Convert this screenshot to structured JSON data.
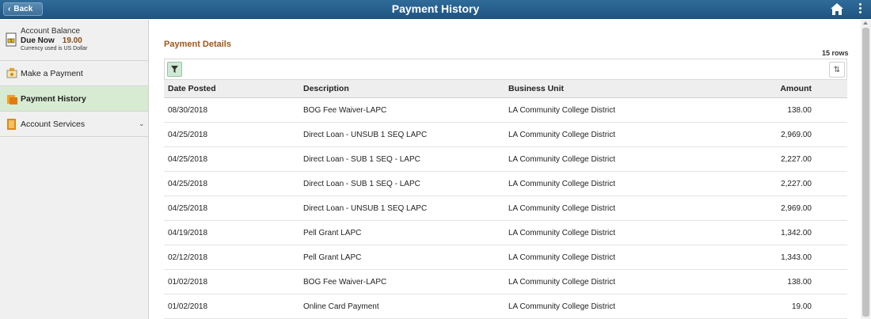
{
  "header": {
    "back_label": "Back",
    "title": "Payment History",
    "home_icon": "home-icon",
    "menu_icon": "kebab-menu-icon"
  },
  "sidebar": {
    "account": {
      "title": "Account Balance",
      "due_label": "Due Now",
      "due_amount": "19.00",
      "currency_note": "Currency used is US Dollar"
    },
    "items": [
      {
        "label": "Make a Payment",
        "icon": "payment-icon",
        "active": false
      },
      {
        "label": "Payment History",
        "icon": "history-icon",
        "active": true
      },
      {
        "label": "Account Services",
        "icon": "services-icon",
        "active": false,
        "expandable": true
      }
    ]
  },
  "main": {
    "section_title": "Payment Details",
    "row_count": "15 rows",
    "columns": [
      "Date Posted",
      "Description",
      "Business Unit",
      "Amount"
    ],
    "rows": [
      [
        "08/30/2018",
        "BOG Fee Waiver-LAPC",
        "LA Community College District",
        "138.00"
      ],
      [
        "04/25/2018",
        "Direct Loan - UNSUB 1 SEQ LAPC",
        "LA Community College District",
        "2,969.00"
      ],
      [
        "04/25/2018",
        "Direct Loan - SUB 1 SEQ - LAPC",
        "LA Community College District",
        "2,227.00"
      ],
      [
        "04/25/2018",
        "Direct Loan - SUB 1 SEQ - LAPC",
        "LA Community College District",
        "2,227.00"
      ],
      [
        "04/25/2018",
        "Direct Loan - UNSUB 1 SEQ LAPC",
        "LA Community College District",
        "2,969.00"
      ],
      [
        "04/19/2018",
        "Pell Grant LAPC",
        "LA Community College District",
        "1,342.00"
      ],
      [
        "02/12/2018",
        "Pell Grant LAPC",
        "LA Community College District",
        "1,343.00"
      ],
      [
        "01/02/2018",
        "BOG Fee Waiver-LAPC",
        "LA Community College District",
        "138.00"
      ],
      [
        "01/02/2018",
        "Online Card Payment",
        "LA Community College District",
        "19.00"
      ]
    ]
  },
  "colors": {
    "header_bg": "#245d8c",
    "active_nav_bg": "#d7ebd3",
    "section_title": "#a0571a",
    "due_amount": "#8a4a0e"
  }
}
